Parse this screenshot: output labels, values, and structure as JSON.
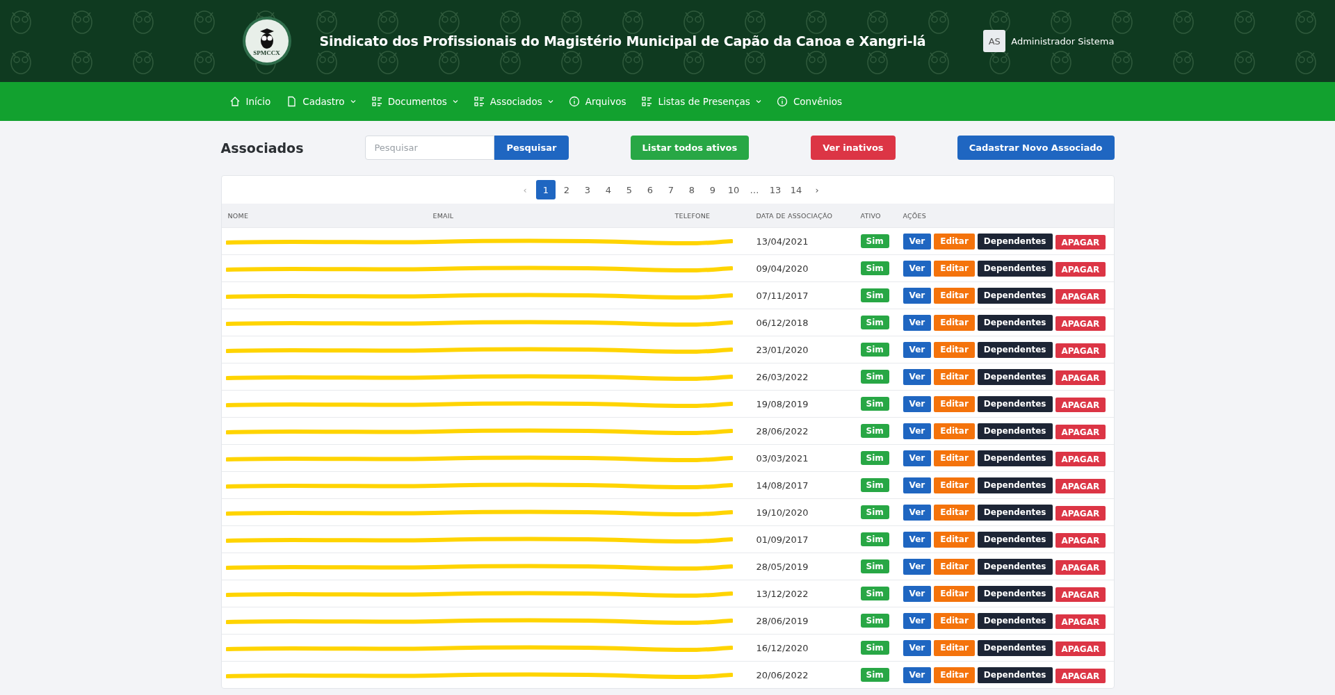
{
  "header": {
    "logo_text": "SPMCCX",
    "title": "Sindicato dos Profissionais do Magistério Municipal de Capão da Canoa e Xangri-lá",
    "user": {
      "initials": "AS",
      "name": "Administrador Sistema"
    }
  },
  "nav": [
    {
      "label": "Início",
      "dropdown": false
    },
    {
      "label": "Cadastro",
      "dropdown": true
    },
    {
      "label": "Documentos",
      "dropdown": true
    },
    {
      "label": "Associados",
      "dropdown": true
    },
    {
      "label": "Arquivos",
      "dropdown": false
    },
    {
      "label": "Listas de Presenças",
      "dropdown": true
    },
    {
      "label": "Convênios",
      "dropdown": false
    }
  ],
  "toolbar": {
    "title": "Associados",
    "search": {
      "placeholder": "Pesquisar",
      "button": "Pesquisar"
    },
    "buttons": [
      {
        "label": "Listar todos ativos",
        "kind": "success"
      },
      {
        "label": "Ver inativos",
        "kind": "danger"
      },
      {
        "label": "Cadastrar Novo Associado",
        "kind": "primary"
      }
    ]
  },
  "pagination": {
    "prev": "‹",
    "next": "›",
    "pages": [
      {
        "label": "1",
        "selected": true
      },
      {
        "label": "2",
        "selected": false
      },
      {
        "label": "3",
        "selected": false
      },
      {
        "label": "4",
        "selected": false
      },
      {
        "label": "5",
        "selected": false
      },
      {
        "label": "6",
        "selected": false
      },
      {
        "label": "7",
        "selected": false
      },
      {
        "label": "8",
        "selected": false
      },
      {
        "label": "9",
        "selected": false
      },
      {
        "label": "10",
        "selected": false
      },
      {
        "label": "…",
        "selected": false
      },
      {
        "label": "13",
        "selected": false
      },
      {
        "label": "14",
        "selected": false
      }
    ]
  },
  "table": {
    "columns": [
      "NOME",
      "EMAIL",
      "TELEFONE",
      "DATA DE ASSOCIAÇÃO",
      "ATIVO",
      "AÇÕES"
    ],
    "rows": [
      {
        "redacted": true,
        "date": "13/04/2021",
        "active": "Sim",
        "actions": [
          "Ver",
          "Editar",
          "Dependentes",
          "APAGAR"
        ]
      },
      {
        "redacted": true,
        "date": "09/04/2020",
        "active": "Sim",
        "actions": [
          "Ver",
          "Editar",
          "Dependentes",
          "APAGAR"
        ]
      },
      {
        "redacted": true,
        "date": "07/11/2017",
        "active": "Sim",
        "actions": [
          "Ver",
          "Editar",
          "Dependentes",
          "APAGAR"
        ]
      },
      {
        "redacted": true,
        "date": "06/12/2018",
        "active": "Sim",
        "actions": [
          "Ver",
          "Editar",
          "Dependentes",
          "APAGAR"
        ]
      },
      {
        "redacted": true,
        "date": "23/01/2020",
        "active": "Sim",
        "actions": [
          "Ver",
          "Editar",
          "Dependentes",
          "APAGAR"
        ]
      },
      {
        "redacted": true,
        "date": "26/03/2022",
        "active": "Sim",
        "actions": [
          "Ver",
          "Editar",
          "Dependentes",
          "APAGAR"
        ]
      },
      {
        "redacted": true,
        "date": "19/08/2019",
        "active": "Sim",
        "actions": [
          "Ver",
          "Editar",
          "Dependentes",
          "APAGAR"
        ]
      },
      {
        "redacted": true,
        "date": "28/06/2022",
        "active": "Sim",
        "actions": [
          "Ver",
          "Editar",
          "Dependentes",
          "APAGAR"
        ]
      },
      {
        "redacted": true,
        "date": "03/03/2021",
        "active": "Sim",
        "actions": [
          "Ver",
          "Editar",
          "Dependentes",
          "APAGAR"
        ]
      },
      {
        "redacted": true,
        "date": "14/08/2017",
        "active": "Sim",
        "actions": [
          "Ver",
          "Editar",
          "Dependentes",
          "APAGAR"
        ]
      },
      {
        "redacted": true,
        "date": "19/10/2020",
        "active": "Sim",
        "actions": [
          "Ver",
          "Editar",
          "Dependentes",
          "APAGAR"
        ]
      },
      {
        "redacted": true,
        "date": "01/09/2017",
        "active": "Sim",
        "actions": [
          "Ver",
          "Editar",
          "Dependentes",
          "APAGAR"
        ]
      },
      {
        "redacted": true,
        "date": "28/05/2019",
        "active": "Sim",
        "actions": [
          "Ver",
          "Editar",
          "Dependentes",
          "APAGAR"
        ]
      },
      {
        "redacted": true,
        "date": "13/12/2022",
        "active": "Sim",
        "actions": [
          "Ver",
          "Editar",
          "Dependentes",
          "APAGAR"
        ]
      },
      {
        "redacted": true,
        "date": "28/06/2019",
        "active": "Sim",
        "actions": [
          "Ver",
          "Editar",
          "Dependentes",
          "APAGAR"
        ]
      },
      {
        "redacted": true,
        "date": "16/12/2020",
        "active": "Sim",
        "actions": [
          "Ver",
          "Editar",
          "Dependentes",
          "APAGAR"
        ]
      },
      {
        "redacted": true,
        "date": "20/06/2022",
        "active": "Sim",
        "actions": [
          "Ver",
          "Editar",
          "Dependentes",
          "APAGAR"
        ]
      }
    ]
  }
}
